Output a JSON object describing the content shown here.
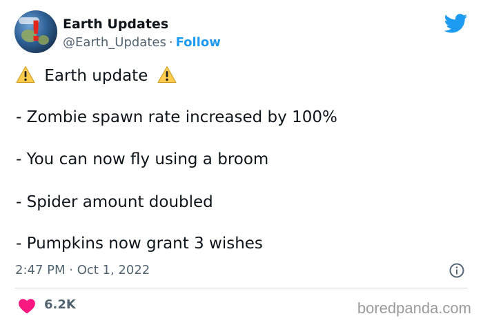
{
  "tweet": {
    "author_name": "Earth Updates",
    "handle": "@Earth_Updates",
    "separator": "·",
    "follow_label": "Follow",
    "title_line": "Earth update",
    "lines": [
      "- Zombie spawn rate increased by 100%",
      "- You can now fly using a broom",
      "- Spider amount doubled",
      "- Pumpkins now grant 3 wishes"
    ],
    "timestamp": "2:47 PM · Oct 1, 2022",
    "like_count": "6.2K"
  },
  "watermark": "boredpanda.com",
  "icons": {
    "platform": "twitter-bird-icon",
    "warning": "warning-sign-icon",
    "info": "info-icon",
    "like": "heart-icon"
  },
  "colors": {
    "accent": "#1d9bf0",
    "text": "#0f1419",
    "muted": "#536471",
    "like": "#f91880",
    "warning": "#ffcc4d"
  }
}
